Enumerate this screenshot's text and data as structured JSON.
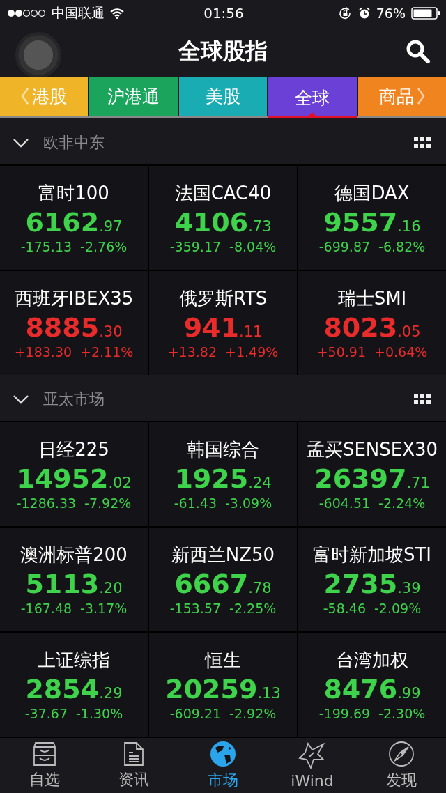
{
  "status_bar": {
    "carrier": "中国联通",
    "time": "01:56",
    "battery": "76%"
  },
  "header": {
    "title": "全球股指"
  },
  "tabs": [
    {
      "label": "港股",
      "color": "#f0b428",
      "selected": false,
      "kind": "prev"
    },
    {
      "label": "沪港通",
      "color": "#1ba45c",
      "selected": false
    },
    {
      "label": "美股",
      "color": "#19acb3",
      "selected": false
    },
    {
      "label": "全球",
      "color": "#6a40d6",
      "selected": true
    },
    {
      "label": "商品",
      "color": "#f0841e",
      "selected": false,
      "kind": "next"
    }
  ],
  "sections": [
    {
      "title": "欧非中东",
      "expanded": true,
      "quotes": [
        {
          "name": "富时100",
          "price": "6162",
          "decimals": ".97",
          "change": "-175.13",
          "percent": "-2.76%",
          "kind": "down"
        },
        {
          "name": "法国CAC40",
          "price": "4106",
          "decimals": ".73",
          "change": "-359.17",
          "percent": "-8.04%",
          "kind": "down"
        },
        {
          "name": "德国DAX",
          "price": "9557",
          "decimals": ".16",
          "change": "-699.87",
          "percent": "-6.82%",
          "kind": "down"
        },
        {
          "name": "西班牙IBEX35",
          "price": "8885",
          "decimals": ".30",
          "change": "+183.30",
          "percent": "+2.11%",
          "kind": "up"
        },
        {
          "name": "俄罗斯RTS",
          "price": "941",
          "decimals": ".11",
          "change": "+13.82",
          "percent": "+1.49%",
          "kind": "up"
        },
        {
          "name": "瑞士SMI",
          "price": "8023",
          "decimals": ".05",
          "change": "+50.91",
          "percent": "+0.64%",
          "kind": "up"
        }
      ]
    },
    {
      "title": "亚太市场",
      "expanded": true,
      "quotes": [
        {
          "name": "日经225",
          "price": "14952",
          "decimals": ".02",
          "change": "-1286.33",
          "percent": "-7.92%",
          "kind": "down"
        },
        {
          "name": "韩国综合",
          "price": "1925",
          "decimals": ".24",
          "change": "-61.43",
          "percent": "-3.09%",
          "kind": "down"
        },
        {
          "name": "孟买SENSEX30",
          "price": "26397",
          "decimals": ".71",
          "change": "-604.51",
          "percent": "-2.24%",
          "kind": "down"
        },
        {
          "name": "澳洲标普200",
          "price": "5113",
          "decimals": ".20",
          "change": "-167.48",
          "percent": "-3.17%",
          "kind": "down"
        },
        {
          "name": "新西兰NZ50",
          "price": "6667",
          "decimals": ".78",
          "change": "-153.57",
          "percent": "-2.25%",
          "kind": "down"
        },
        {
          "name": "富时新加坡STI",
          "price": "2735",
          "decimals": ".39",
          "change": "-58.46",
          "percent": "-2.09%",
          "kind": "down"
        },
        {
          "name": "上证综指",
          "price": "2854",
          "decimals": ".29",
          "change": "-37.67",
          "percent": "-1.30%",
          "kind": "down"
        },
        {
          "name": "恒生",
          "price": "20259",
          "decimals": ".13",
          "change": "-609.21",
          "percent": "-2.92%",
          "kind": "down"
        },
        {
          "name": "台湾加权",
          "price": "8476",
          "decimals": ".99",
          "change": "-199.69",
          "percent": "-2.30%",
          "kind": "down"
        }
      ]
    }
  ],
  "bottom_nav": [
    {
      "label": "自选",
      "kind": "inbox",
      "selected": false
    },
    {
      "label": "资讯",
      "kind": "document",
      "selected": false
    },
    {
      "label": "市场",
      "kind": "globe",
      "selected": true
    },
    {
      "label": "iWind",
      "kind": "star",
      "selected": false
    },
    {
      "label": "发现",
      "kind": "compass",
      "selected": false
    }
  ]
}
